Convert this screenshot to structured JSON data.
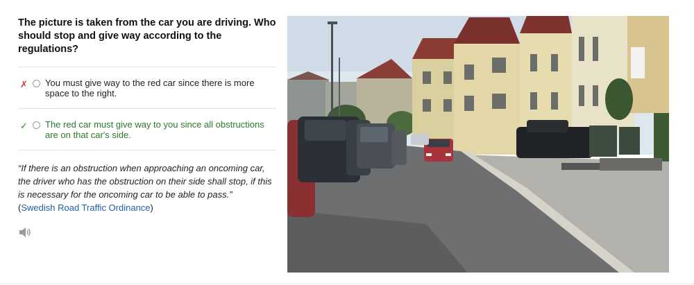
{
  "question": {
    "text": "The picture is taken from the car you are driving. Who should stop and give way according to the regulations?"
  },
  "answers": [
    {
      "mark": "✗",
      "status": "incorrect",
      "text": "You must give way to the red car since there is more space to the right."
    },
    {
      "mark": "✓",
      "status": "correct",
      "text": "The red car must give way to you since all obstructions are on that car's side."
    }
  ],
  "explanation": {
    "quote": "“If there is an obstruction when approaching an oncoming car, the driver who has the obstruction on their side shall stop, if this is necessary for the oncoming car to be able to pass.”",
    "source_prefix": "(",
    "source_link": "Swedish Road Traffic Ordinance",
    "source_suffix": ")"
  },
  "audio": {
    "icon": "speaker-icon"
  },
  "photo": {
    "description_icon": "street-photo",
    "colors": {
      "sky": "#dfe7ee",
      "road": "#6e6f70",
      "red_car": "#a8333b"
    }
  },
  "colors": {
    "correct": "#2a7a2a",
    "incorrect": "#d23a3a",
    "link": "#1f5fa8"
  }
}
